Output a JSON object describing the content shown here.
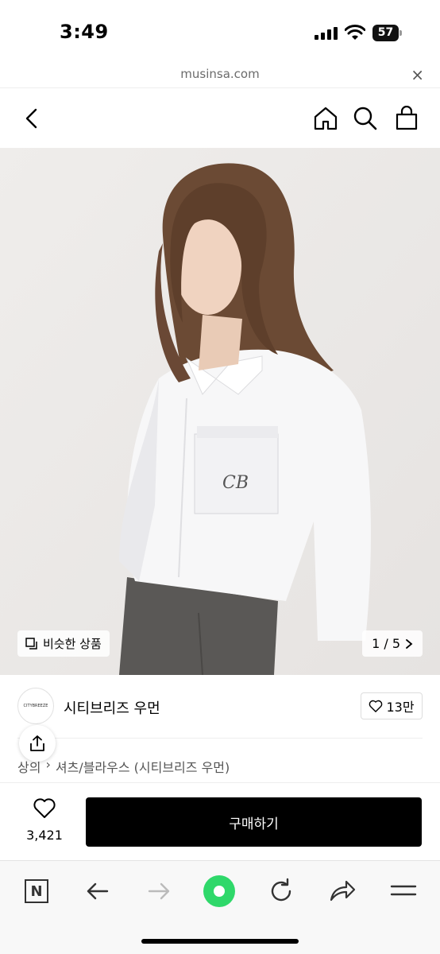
{
  "status": {
    "time": "3:49",
    "battery": "57"
  },
  "browser": {
    "url": "musinsa.com",
    "close": "×"
  },
  "header": {
    "back_icon": "chevron-left-icon",
    "home_icon": "home-icon",
    "search_icon": "search-icon",
    "cart_icon": "shopping-bag-icon"
  },
  "image": {
    "similar_label": "비슷한 상품",
    "page": "1 / 5",
    "embroidered_logo": "CB"
  },
  "brand": {
    "logo_text": "CITYBREEZE",
    "name": "시티브리즈 우먼",
    "likes": "13만"
  },
  "breadcrumb": [
    "상의",
    "셔츠/블라우스 (시티브리즈 우먼)"
  ],
  "purchase": {
    "wish_count": "3,421",
    "buy_label": "구매하기"
  },
  "toolbar": {
    "n_label": "N",
    "accent": "#2fd86a"
  }
}
